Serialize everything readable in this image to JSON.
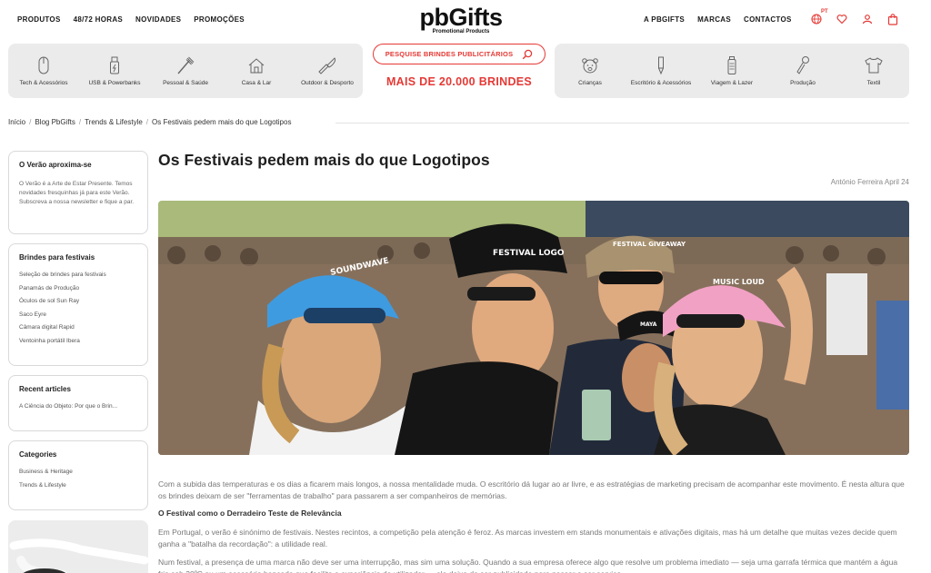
{
  "nav": {
    "left": [
      "PRODUTOS",
      "48/72 HORAS",
      "NOVIDADES",
      "PROMOÇÕES"
    ],
    "right": [
      "A PBGIFTS",
      "MARCAS",
      "CONTACTOS"
    ],
    "lang": "PT"
  },
  "logo": {
    "name": "pbGifts",
    "tagline": "Promotional Products"
  },
  "categories_left": [
    {
      "label": "Tech & Acessórios",
      "icon": "mouse-icon"
    },
    {
      "label": "USB & Powerbanks",
      "icon": "usb-icon"
    },
    {
      "label": "Pessoal & Saúde",
      "icon": "toothbrush-icon"
    },
    {
      "label": "Casa & Lar",
      "icon": "house-icon"
    },
    {
      "label": "Outdoor & Desporto",
      "icon": "knife-icon"
    }
  ],
  "categories_right": [
    {
      "label": "Crianças",
      "icon": "bear-icon"
    },
    {
      "label": "Escritório & Acessórios",
      "icon": "pen-icon"
    },
    {
      "label": "Viagem & Lazer",
      "icon": "bottle-icon"
    },
    {
      "label": "Produção",
      "icon": "paint-icon"
    },
    {
      "label": "Textil",
      "icon": "tshirt-icon"
    }
  ],
  "search": {
    "label": "PESQUISE BRINDES PUBLICITÁRIOS"
  },
  "headline": "MAIS DE 20.000 BRINDES",
  "breadcrumb": [
    "Início",
    "Blog PbGifts",
    "Trends & Lifestyle",
    "Os Festivais pedem mais do que Logotipos"
  ],
  "sidebar": {
    "summer": {
      "title": "O Verão aproxima-se",
      "text": "O Verão é a Arte de Estar Presente. Temos novidades fresquinhas já para este Verão. Subscreva a nossa newsletter e fique a par."
    },
    "festival": {
      "title": "Brindes para festivais",
      "items": [
        "Seleção de brindes para festivais",
        "Panamás de Produção",
        "Óculos de sol Sun Ray",
        "Saco Eyre",
        "Câmara digital Rapid",
        "Ventoinha portátil Ibera"
      ]
    },
    "recent": {
      "title": "Recent articles",
      "items": [
        "A Ciência do Objeto: Por que o Brin..."
      ]
    },
    "categories": {
      "title": "Categories",
      "items": [
        "Business & Heritage",
        "Trends & Lifestyle"
      ]
    }
  },
  "article": {
    "title": "Os Festivais pedem mais do que Logotipos",
    "byline": "António Ferreira April 24",
    "hats": [
      "SOUNDWAVE",
      "FESTIVAL LOGO",
      "FESTIVAL GIVEAWAY",
      "MUSIC LOUD",
      "MAYA"
    ],
    "p1": "Com a subida das temperaturas e os dias a ficarem mais longos, a nossa mentalidade muda. O escritório dá lugar ao ar livre, e as estratégias de marketing precisam de acompanhar este movimento. É nesta altura que os brindes deixam de ser \"ferramentas de trabalho\" para passarem a ser companheiros de memórias.",
    "h2": "O Festival como o Derradeiro Teste de Relevância",
    "p2": "Em Portugal, o verão é sinónimo de festivais. Nestes recintos, a competição pela atenção é feroz. As marcas investem em stands monumentais e ativações digitais, mas há um detalhe que muitas vezes decide quem ganha a \"batalha da recordação\": a utilidade real.",
    "p3": "Num festival, a presença de uma marca não deve ser uma interrupção, mas sim uma solução. Quando a sua empresa oferece algo que resolve um problema imediato — seja uma garrafa térmica que mantém a água fria sob 30ºC ou um acessório bancada que facilita a experiência do utilizador — ele deixa de ser publicidade para passar a ser serviço."
  },
  "colors": {
    "accent": "#e53935",
    "panel": "#ebebeb"
  }
}
